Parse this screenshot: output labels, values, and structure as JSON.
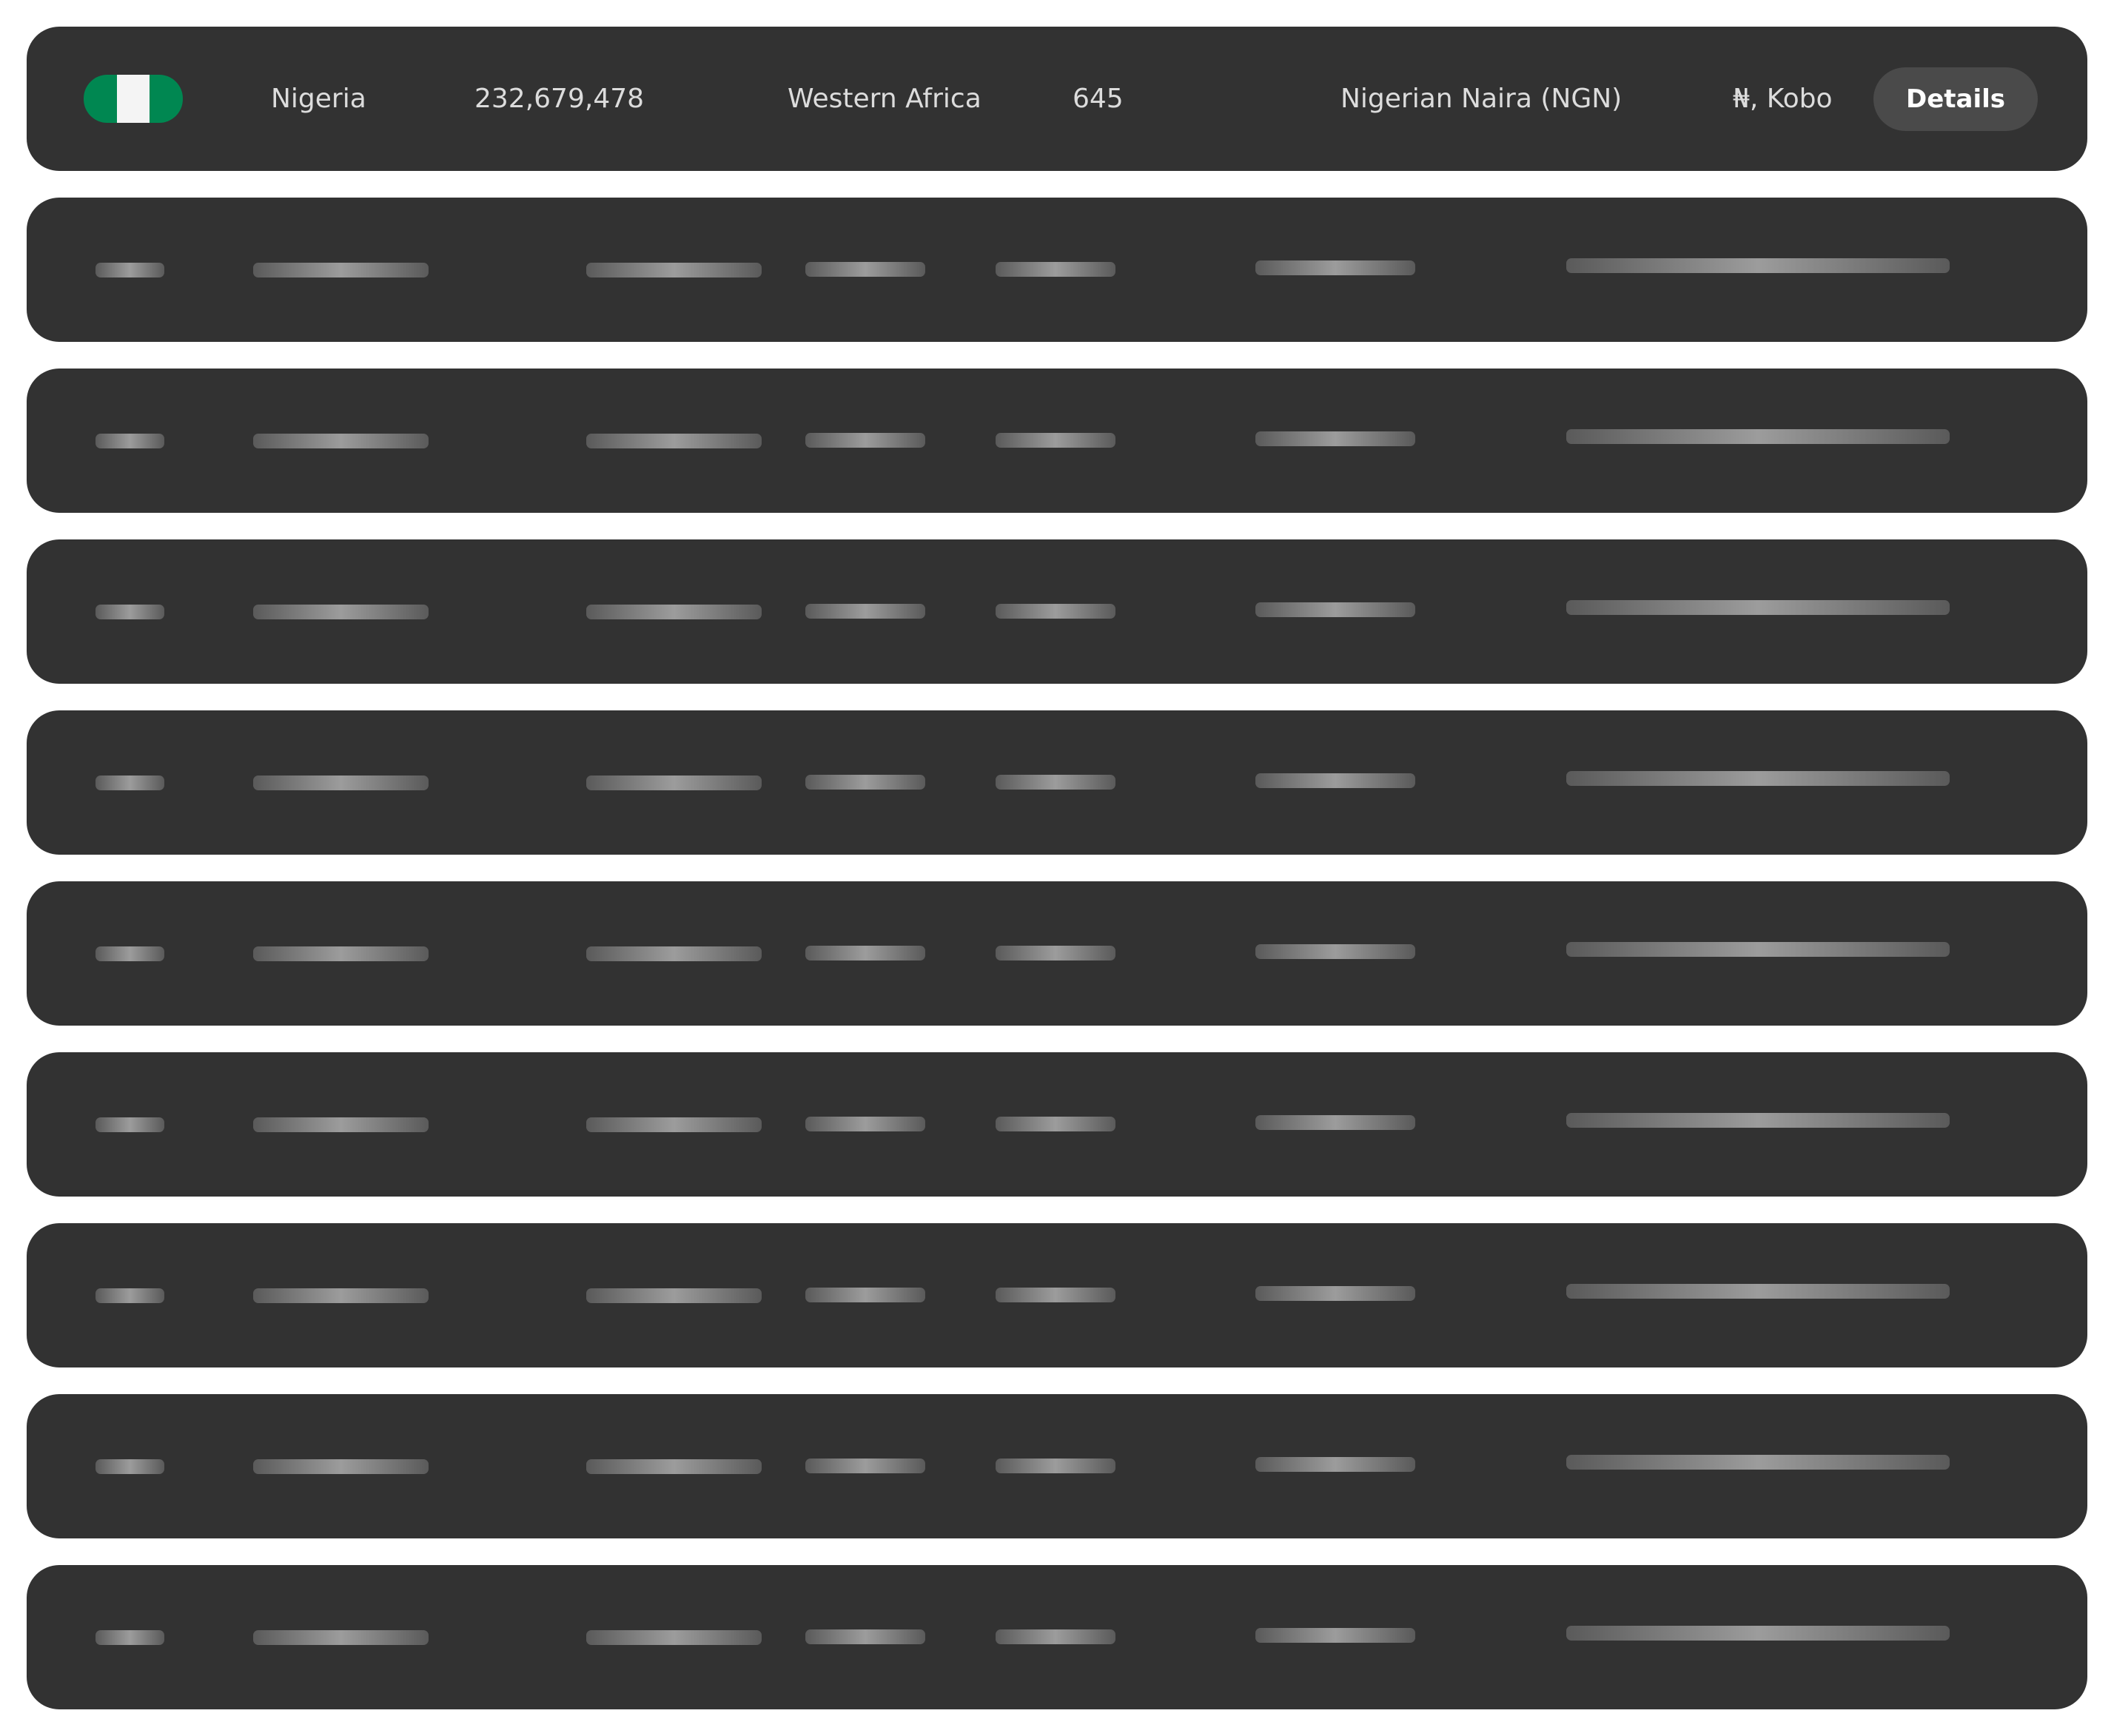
{
  "rows": [
    {
      "flag_icon": "nigeria-flag-icon",
      "flag_colors": [
        "#008751",
        "#f4f4f4",
        "#008751"
      ],
      "name": "Nigeria",
      "population": "232,679,478",
      "region": "Western Africa",
      "area": "645",
      "currency": "Nigerian Naira (NGN)",
      "symbol": "₦, Kobo",
      "action_label": "Details"
    }
  ],
  "skeleton_rows": 9,
  "colors": {
    "row_bg": "#323232",
    "text": "#dcdcdc",
    "button_bg": "#4a4a4a",
    "button_text": "#ffffff",
    "skeleton_dark": "#5a5a5a",
    "skeleton_light": "#9c9c9c"
  }
}
